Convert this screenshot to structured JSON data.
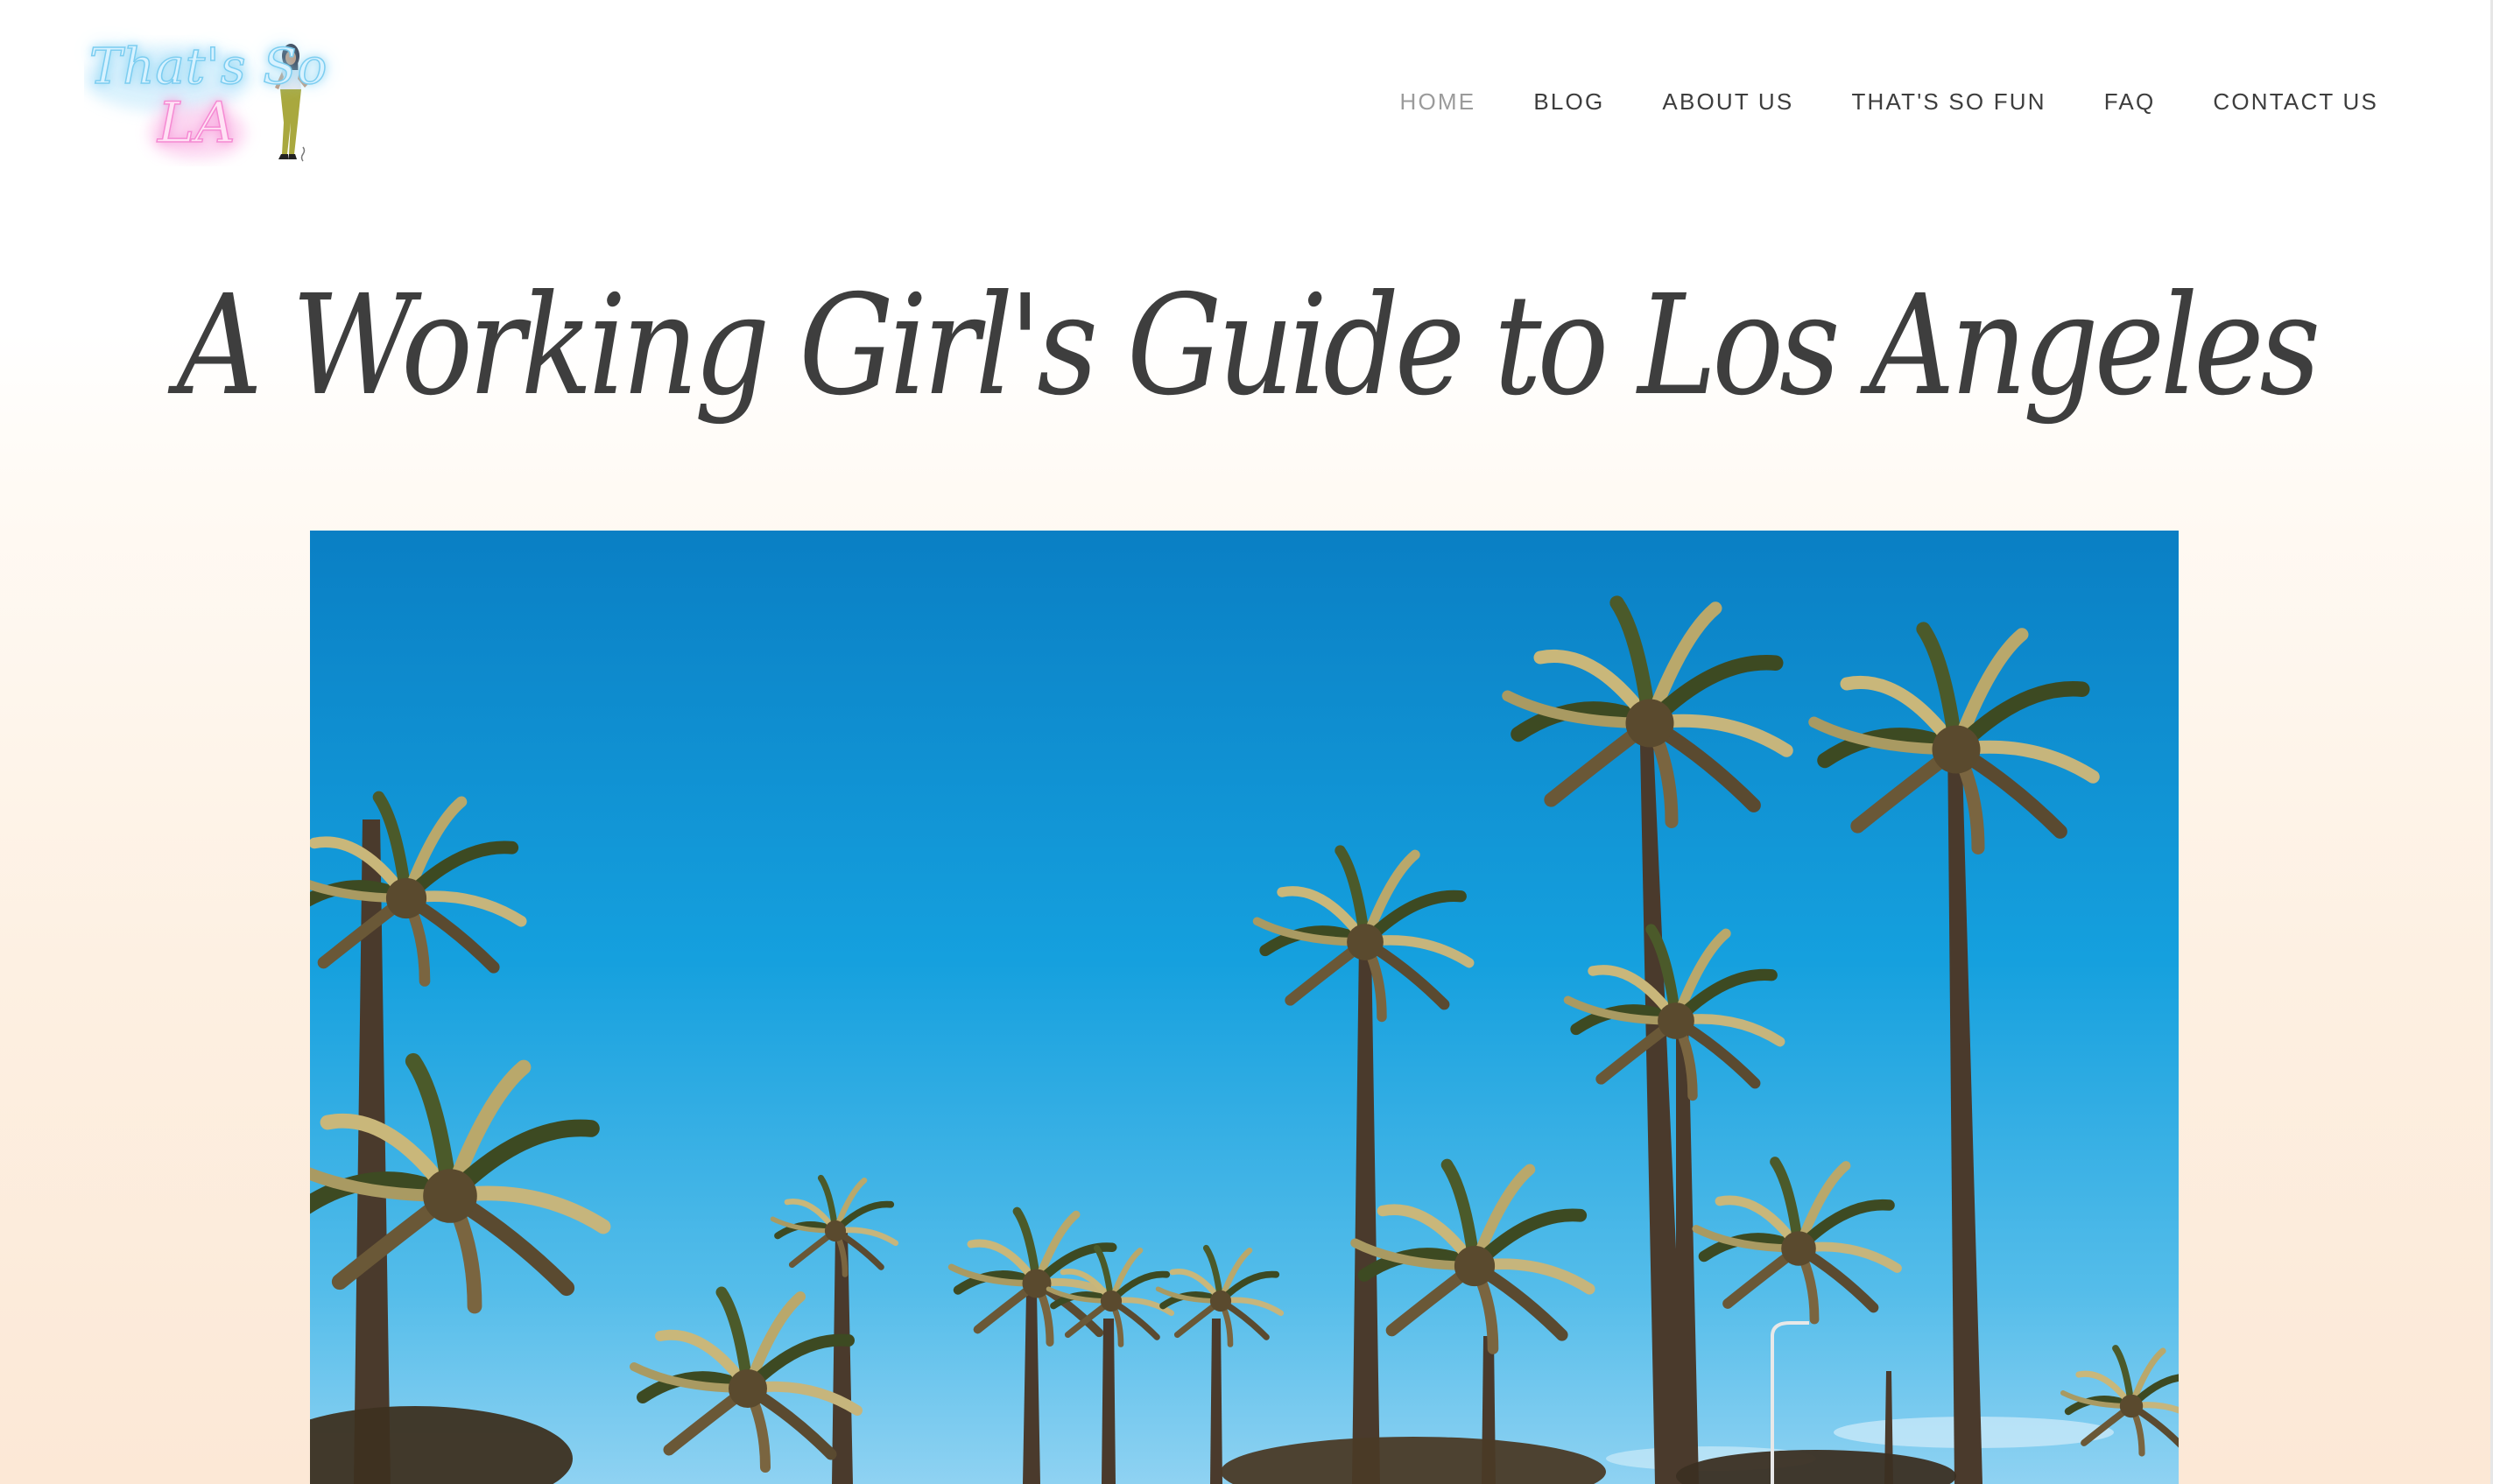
{
  "site": {
    "logo": {
      "line1": "That's So",
      "line2": "LA",
      "colors": {
        "neon_blue": "#7ccdf0",
        "neon_pink": "#f58bd3"
      }
    }
  },
  "nav": {
    "items": [
      {
        "label": "HOME",
        "active": true
      },
      {
        "label": "BLOG",
        "active": false
      },
      {
        "label": "ABOUT US",
        "active": false
      },
      {
        "label": "THAT'S SO FUN",
        "active": false
      },
      {
        "label": "FAQ",
        "active": false
      },
      {
        "label": "CONTACT US",
        "active": false
      }
    ]
  },
  "post": {
    "title": "A Working Girl's Guide to Los Angeles"
  },
  "hero": {
    "icon": "palm-trees-photo",
    "colors": {
      "sky_top": "#0a7fc4",
      "sky_mid": "#1aa2de",
      "sky_bottom": "#7fcbf0",
      "palm_trunk": "#4a3a2c",
      "frond_dark": "#3d4a22",
      "frond_light": "#c9b77a"
    }
  },
  "theme": {
    "text": "#3e3e3e",
    "nav_active": "#9b9b9b",
    "bg_gradient_bottom": "#fce8d6"
  }
}
